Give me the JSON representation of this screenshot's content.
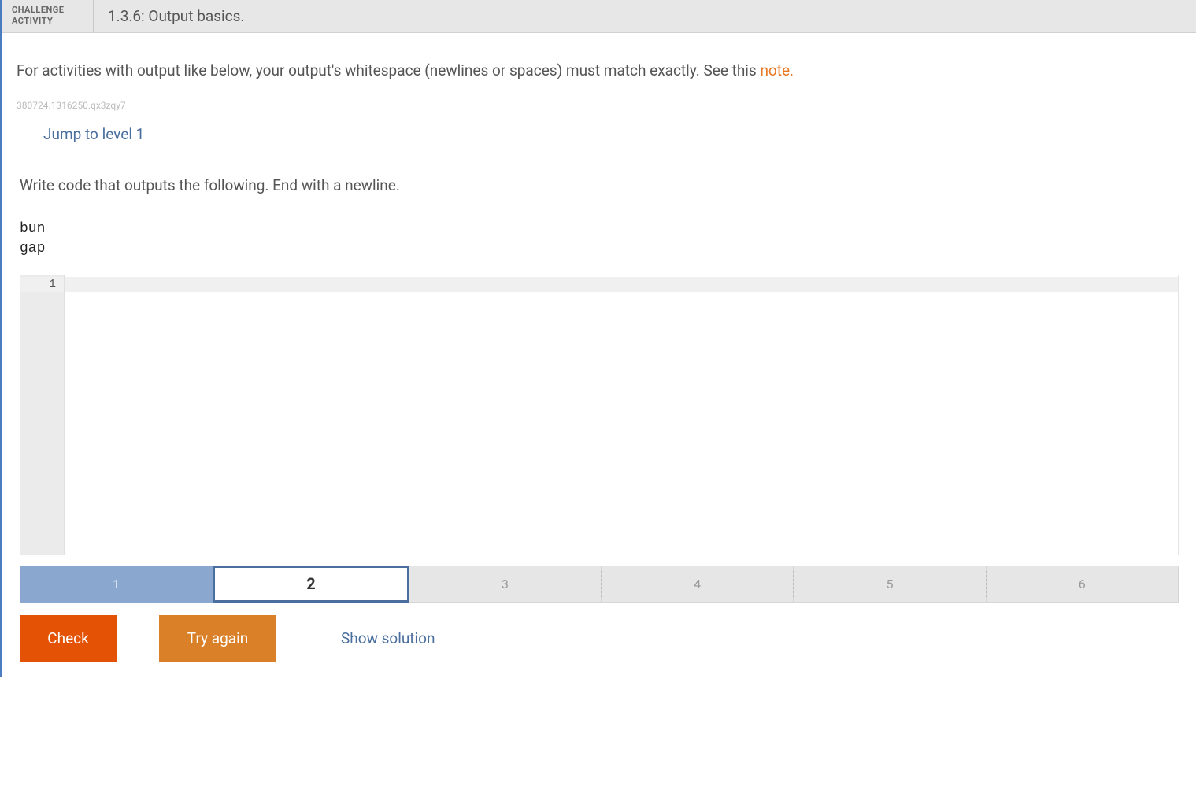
{
  "header": {
    "label_line1": "CHALLENGE",
    "label_line2": "ACTIVITY",
    "title": "1.3.6: Output basics."
  },
  "intro": {
    "text_before": "For activities with output like below, your output's whitespace (newlines or spaces) must match exactly. See this ",
    "link_text": "note.",
    "tracking_id": "380724.1316250.qx3zqy7"
  },
  "jump_link": "Jump to level 1",
  "prompt": "Write code that outputs the following. End with a newline.",
  "expected_output": "bun\ngap",
  "editor": {
    "line_number": "1",
    "code": ""
  },
  "levels": [
    {
      "num": "1",
      "state": "completed"
    },
    {
      "num": "2",
      "state": "active"
    },
    {
      "num": "3",
      "state": "pending"
    },
    {
      "num": "4",
      "state": "pending"
    },
    {
      "num": "5",
      "state": "pending"
    },
    {
      "num": "6",
      "state": "pending"
    }
  ],
  "buttons": {
    "check": "Check",
    "try_again": "Try again",
    "show_solution": "Show solution"
  }
}
